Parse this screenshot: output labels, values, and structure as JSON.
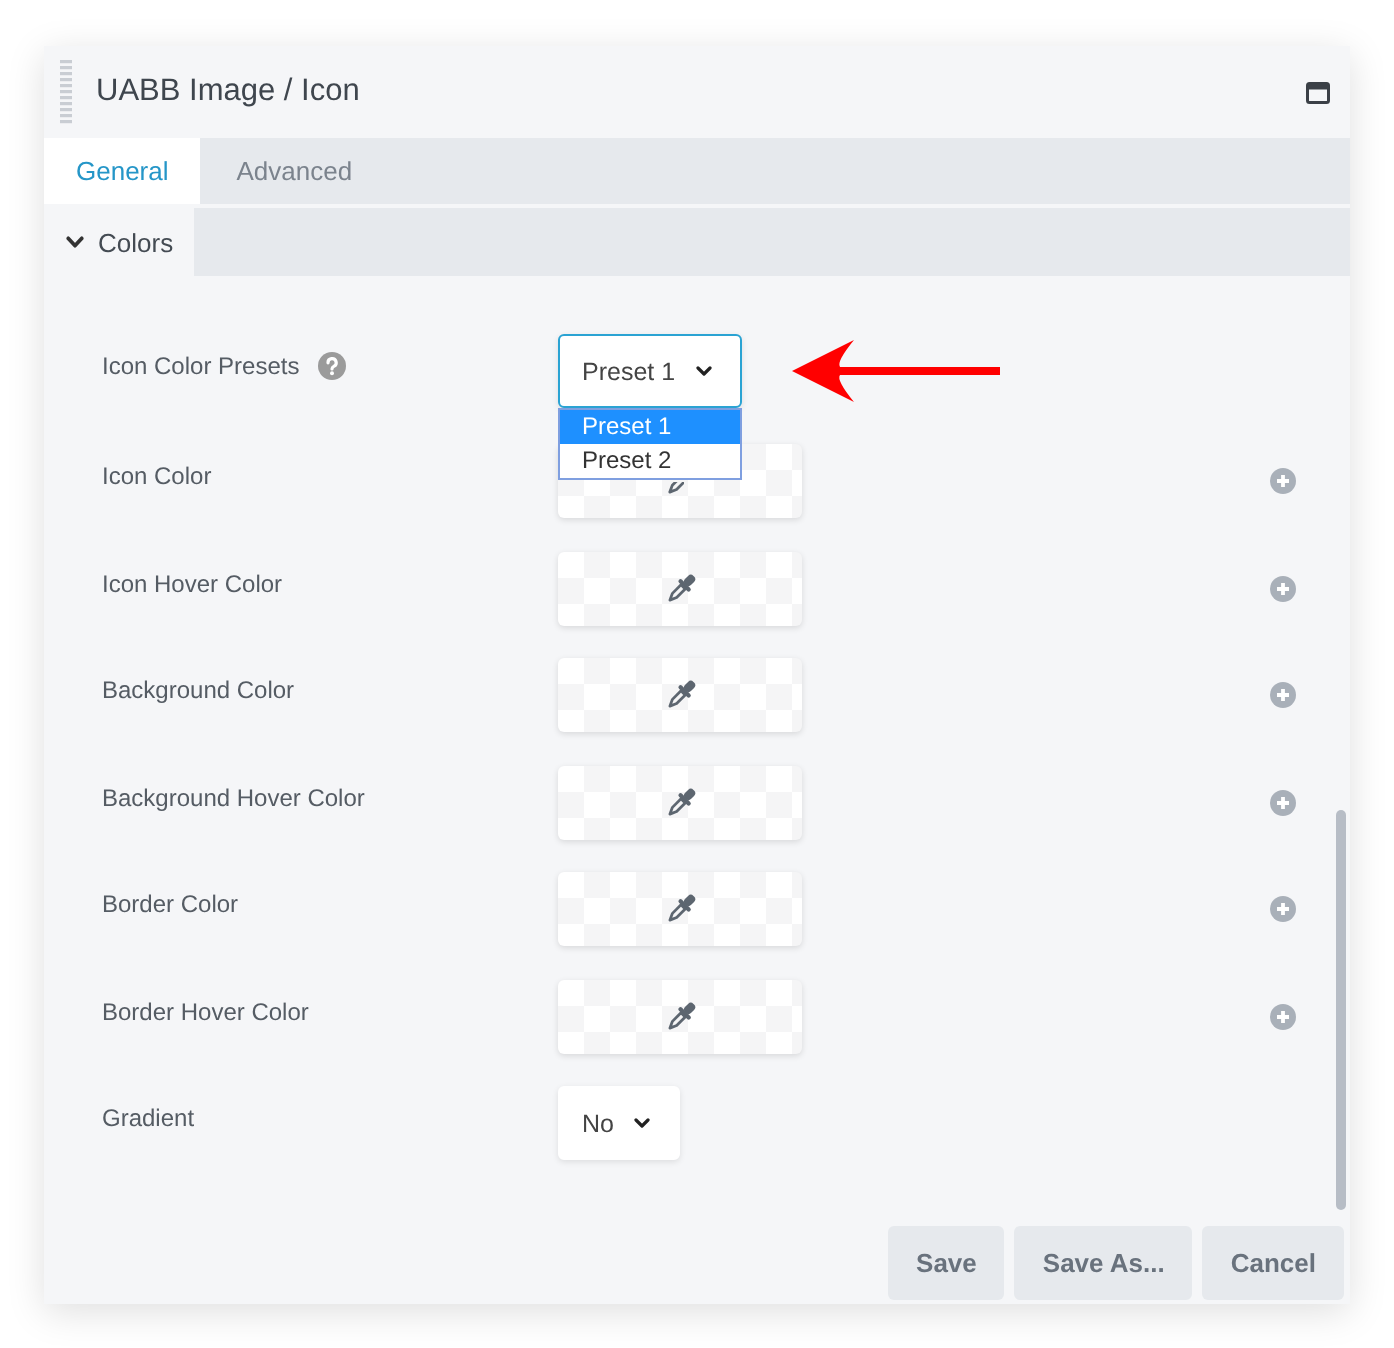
{
  "window": {
    "title": "UABB Image / Icon"
  },
  "tabs": [
    {
      "label": "General",
      "selected": true
    },
    {
      "label": "Advanced",
      "selected": false
    }
  ],
  "section": {
    "title": "Colors",
    "expanded": true
  },
  "fields": [
    {
      "kind": "select",
      "label": "Icon Color Presets",
      "help": true,
      "value": "Preset 1",
      "expanded": true,
      "callout": {
        "kind": "arrow"
      },
      "options": [
        {
          "label": "Preset 1",
          "selected": true
        },
        {
          "label": "Preset 2",
          "selected": false
        }
      ]
    },
    {
      "kind": "color",
      "label": "Icon Color"
    },
    {
      "kind": "color",
      "label": "Icon Hover Color"
    },
    {
      "kind": "color",
      "label": "Background Color"
    },
    {
      "kind": "color",
      "label": "Background Hover Color"
    },
    {
      "kind": "color",
      "label": "Border Color"
    },
    {
      "kind": "color",
      "label": "Border Hover Color"
    },
    {
      "kind": "select",
      "label": "Gradient",
      "value": "No",
      "expanded": false
    }
  ],
  "buttons": [
    {
      "label": "Save"
    },
    {
      "label": "Save As..."
    },
    {
      "label": "Cancel"
    }
  ]
}
